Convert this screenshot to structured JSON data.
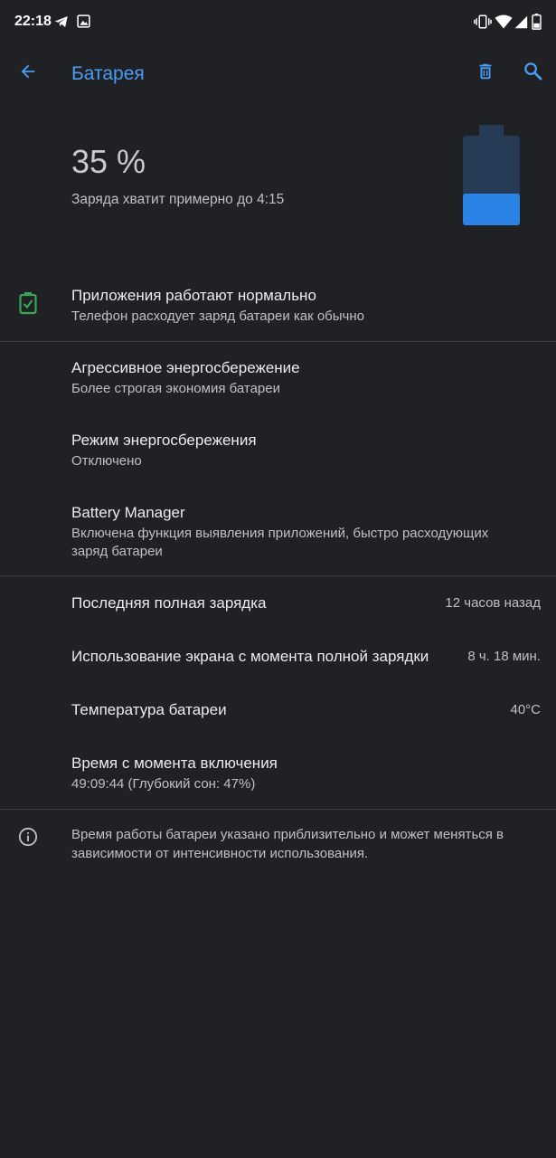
{
  "status_bar": {
    "time": "22:18",
    "icons": [
      "telegram-icon",
      "image-icon",
      "vibrate-icon",
      "wifi-icon",
      "signal-icon",
      "battery-icon"
    ]
  },
  "app_bar": {
    "title": "Батарея",
    "actions": [
      "back-arrow-icon",
      "delete-icon",
      "search-icon"
    ],
    "accent_color": "#4a9df2"
  },
  "header": {
    "percent": "35 %",
    "estimate": "Заряда хватит примерно до 4:15",
    "battery_level": 0.35,
    "battery_fill_color": "#2c83e6",
    "battery_empty_color": "#243a55"
  },
  "status_item": {
    "title": "Приложения работают нормально",
    "subtitle": "Телефон расходует заряд батареи как обычно",
    "icon": "battery-check-icon",
    "icon_color": "#3aa655"
  },
  "settings": [
    {
      "title": "Агрессивное энергосбережение",
      "subtitle": "Более строгая экономия батареи"
    },
    {
      "title": "Режим энергосбережения",
      "subtitle": "Отключено"
    },
    {
      "title": "Battery Manager",
      "subtitle": "Включена функция выявления приложений, быстро расходующих заряд батареи"
    }
  ],
  "stats": [
    {
      "title": "Последняя полная зарядка",
      "value": "12 часов назад"
    },
    {
      "title": "Использование экрана с момента полной зарядки",
      "value": "8 ч. 18 мин."
    },
    {
      "title": "Температура батареи",
      "value": "40°C"
    },
    {
      "title": "Время с момента включения",
      "subtitle": "49:09:44 (Глубокий сон: 47%)"
    }
  ],
  "footer": {
    "icon": "info-icon",
    "text": "Время работы батареи указано приблизительно и может меняться в зависимости от интенсивности использования."
  }
}
